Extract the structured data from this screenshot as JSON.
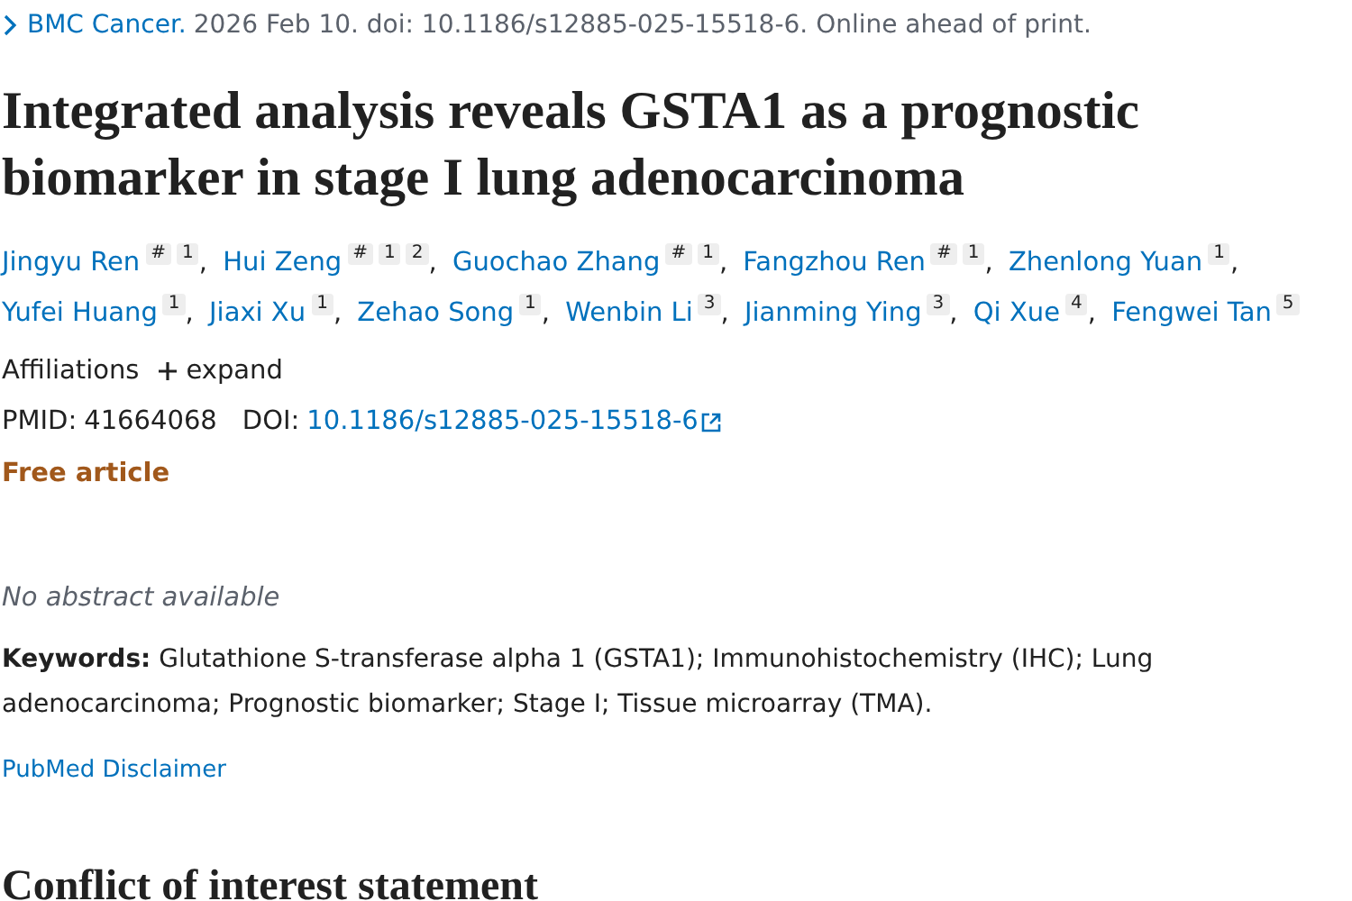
{
  "citation": {
    "journal": "BMC Cancer.",
    "details": "2026 Feb 10. doi: 10.1186/s12885-025-15518-6. Online ahead of print."
  },
  "title": "Integrated analysis reveals GSTA1 as a prognostic biomarker in stage I lung adenocarcinoma",
  "authors": [
    {
      "name": "Jingyu Ren",
      "marks": [
        "#",
        "1"
      ],
      "separator": ","
    },
    {
      "name": "Hui Zeng",
      "marks": [
        "#",
        "1",
        "2"
      ],
      "separator": ","
    },
    {
      "name": "Guochao Zhang",
      "marks": [
        "#",
        "1"
      ],
      "separator": ","
    },
    {
      "name": "Fangzhou Ren",
      "marks": [
        "#",
        "1"
      ],
      "separator": ","
    },
    {
      "name": "Zhenlong Yuan",
      "marks": [
        "1"
      ],
      "separator": ","
    },
    {
      "name": "Yufei Huang",
      "marks": [
        "1"
      ],
      "separator": ","
    },
    {
      "name": "Jiaxi Xu",
      "marks": [
        "1"
      ],
      "separator": ","
    },
    {
      "name": "Zehao Song",
      "marks": [
        "1"
      ],
      "separator": ","
    },
    {
      "name": "Wenbin Li",
      "marks": [
        "3"
      ],
      "separator": ","
    },
    {
      "name": "Jianming Ying",
      "marks": [
        "3"
      ],
      "separator": ","
    },
    {
      "name": "Qi Xue",
      "marks": [
        "4"
      ],
      "separator": ","
    },
    {
      "name": "Fengwei Tan",
      "marks": [
        "5"
      ]
    }
  ],
  "affiliations": {
    "label": "Affiliations",
    "toggle": "expand",
    "expanded": false
  },
  "ids": {
    "pmid_label": "PMID:",
    "pmid": "41664068",
    "doi_label": "DOI:",
    "doi": "10.1186/s12885-025-15518-6"
  },
  "free_article": "Free article",
  "abstract_note": "No abstract available",
  "keywords": "**Keywords:** Glutathione S-transferase alpha 1 (GSTA1); Immunohistochemistry (IHC); Lung adenocarcinoma; Prognostic biomarker; Stage I; Tissue microarray (TMA).",
  "disclaimer_link": "PubMed Disclaimer",
  "section_heading": "Conflict of interest statement"
}
